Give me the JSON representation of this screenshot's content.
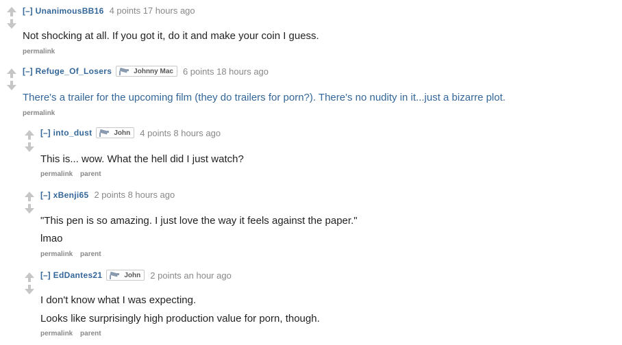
{
  "comments": [
    {
      "collapse": "[–]",
      "author": "UnanimousBB16",
      "flair": "",
      "score_time": "4 points 17 hours ago",
      "paragraphs": [
        "Not shocking at all. If you got it, do it and make your coin I guess."
      ],
      "buttons": [
        "permalink"
      ]
    },
    {
      "collapse": "[–]",
      "author": "Refuge_Of_Losers",
      "flair": "Johnny Mac",
      "score_time": "6 points 18 hours ago",
      "paragraphs": [
        "There's a trailer for the upcoming film (they do trailers for porn?). There's no nudity in it...just a bizarre plot."
      ],
      "buttons": [
        "permalink"
      ]
    },
    {
      "collapse": "[–]",
      "author": "into_dust",
      "flair": "John",
      "score_time": "4 points 8 hours ago",
      "paragraphs": [
        "This is... wow. What the hell did I just watch?"
      ],
      "buttons": [
        "permalink",
        "parent"
      ]
    },
    {
      "collapse": "[–]",
      "author": "xBenji65",
      "flair": "",
      "score_time": "2 points 8 hours ago",
      "paragraphs": [
        "\"This pen is so amazing. I just love the way it feels against the paper.\"",
        "lmao"
      ],
      "buttons": [
        "permalink",
        "parent"
      ]
    },
    {
      "collapse": "[–]",
      "author": "EdDantes21",
      "flair": "John",
      "score_time": "2 points an hour ago",
      "paragraphs": [
        "I don't know what I was expecting.",
        "Looks like surprisingly high production value for porn, though."
      ],
      "buttons": [
        "permalink",
        "parent"
      ]
    }
  ]
}
